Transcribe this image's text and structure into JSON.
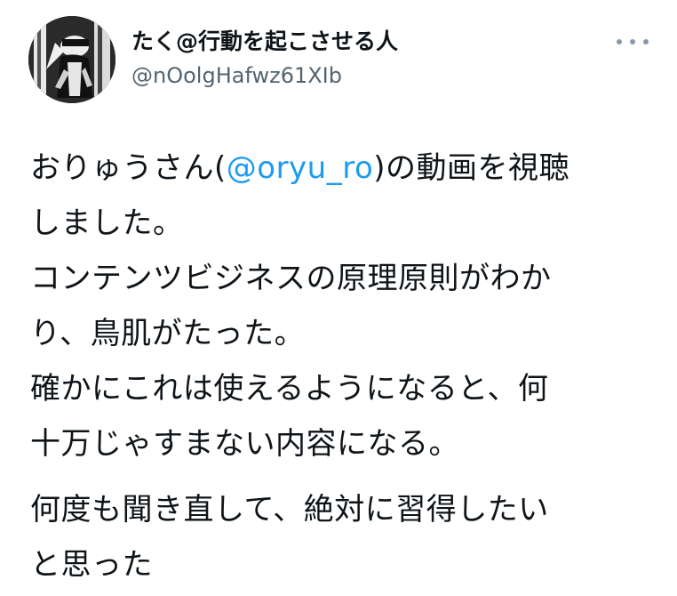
{
  "tweet": {
    "author": {
      "display_name": "たく@行動を起こさせる人",
      "handle": "@nOolgHafwz61XIb"
    },
    "more_icon": "more-horizontal-icon",
    "body": {
      "line1_before": "おりゅうさん(",
      "mention": "@oryu_ro",
      "line1_after": ")の動画を視聴",
      "line2": "しました。",
      "line3": "コンテンツビジネスの原理原則がわか",
      "line4": "り、鳥肌がたった。",
      "line5": "確かにこれは使えるようになると、何",
      "line6": "十万じゃすまない内容になる。",
      "line7": "何度も聞き直して、絶対に習得したい",
      "line8": "と思った"
    },
    "colors": {
      "text": "#0f1419",
      "secondary": "#536471",
      "mention": "#1d9bf0"
    }
  }
}
